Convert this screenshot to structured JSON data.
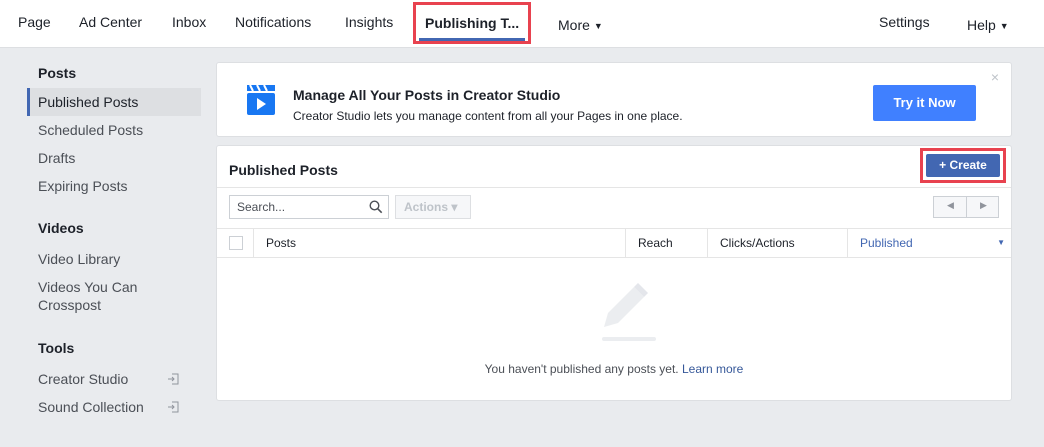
{
  "nav": {
    "page": "Page",
    "ad_center": "Ad Center",
    "inbox": "Inbox",
    "notifications": "Notifications",
    "insights": "Insights",
    "publishing_tools": "Publishing T...",
    "more": "More",
    "settings": "Settings",
    "help": "Help"
  },
  "sidebar": {
    "posts_heading": "Posts",
    "published_posts": "Published Posts",
    "scheduled_posts": "Scheduled Posts",
    "drafts": "Drafts",
    "expiring_posts": "Expiring Posts",
    "videos_heading": "Videos",
    "video_library": "Video Library",
    "videos_crosspost": "Videos You Can Crosspost",
    "tools_heading": "Tools",
    "creator_studio": "Creator Studio",
    "sound_collection": "Sound Collection"
  },
  "banner": {
    "title": "Manage All Your Posts in Creator Studio",
    "subtitle": "Creator Studio lets you manage content from all your Pages in one place.",
    "cta": "Try it Now",
    "close": "×"
  },
  "panel": {
    "title": "Published Posts",
    "create_label": "+ Create",
    "search_placeholder": "Search...",
    "actions_label": "Actions ▾",
    "columns": [
      "Posts",
      "Reach",
      "Clicks/Actions",
      "Published"
    ],
    "empty_text": "You haven't published any posts yet.",
    "learn_more": "Learn more"
  },
  "colors": {
    "accent": "#4267b2",
    "highlight": "#e8424f",
    "cta": "#4080ff"
  }
}
